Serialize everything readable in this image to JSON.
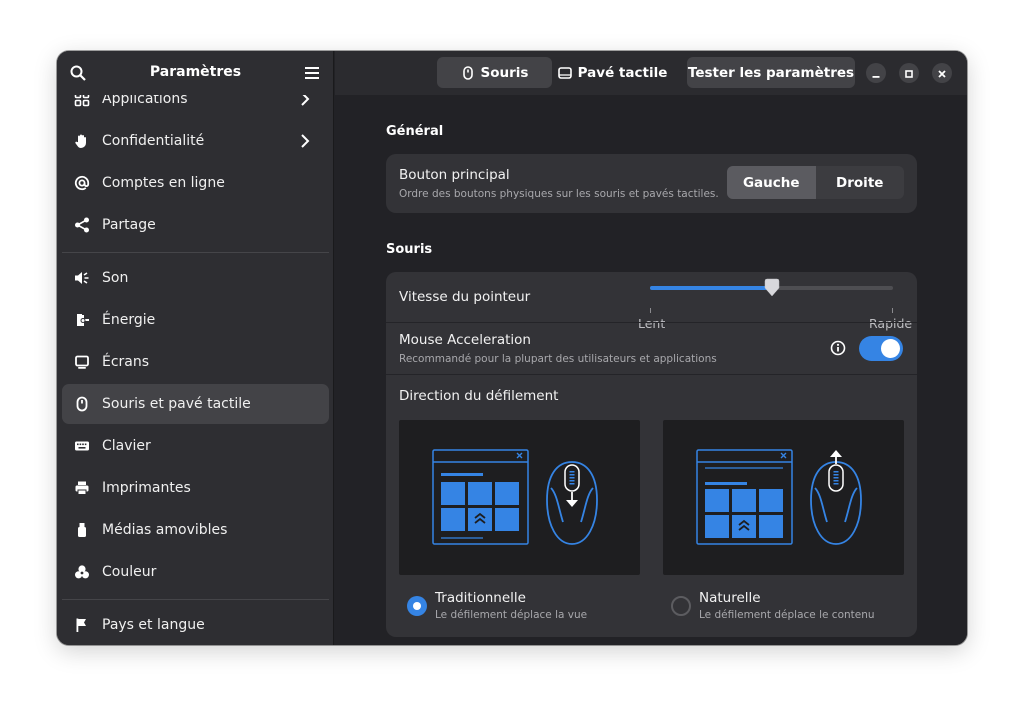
{
  "sidebar": {
    "title": "Paramètres",
    "items": [
      {
        "label": "Applications",
        "icon": "applications-icon"
      },
      {
        "label": "Confidentialité",
        "icon": "hand-icon"
      },
      {
        "label": "Comptes en ligne",
        "icon": "at-sign-icon"
      },
      {
        "label": "Partage",
        "icon": "share-icon"
      },
      {
        "label": "Son",
        "icon": "speaker-icon"
      },
      {
        "label": "Énergie",
        "icon": "battery-plug-icon"
      },
      {
        "label": "Écrans",
        "icon": "display-icon"
      },
      {
        "label": "Souris et pavé tactile",
        "icon": "mouse-icon"
      },
      {
        "label": "Clavier",
        "icon": "keyboard-icon"
      },
      {
        "label": "Imprimantes",
        "icon": "printer-icon"
      },
      {
        "label": "Médias amovibles",
        "icon": "usb-icon"
      },
      {
        "label": "Couleur",
        "icon": "color-icon"
      },
      {
        "label": "Pays et langue",
        "icon": "flag-icon"
      }
    ]
  },
  "header": {
    "tab_mouse": "Souris",
    "tab_touchpad": "Pavé tactile",
    "test_button": "Tester les paramètres"
  },
  "general": {
    "section_title": "Général",
    "primary_button_title": "Bouton principal",
    "primary_button_sub": "Ordre des boutons physiques sur les souris et pavés tactiles.",
    "left": "Gauche",
    "right": "Droite",
    "selected": "Gauche"
  },
  "mouse": {
    "section_title": "Souris",
    "speed_title": "Vitesse du pointeur",
    "speed_min_label": "Lent",
    "speed_max_label": "Rapide",
    "speed_value": 0.5,
    "accel_title": "Mouse Acceleration",
    "accel_sub": "Recommandé pour la plupart des utilisateurs et applications",
    "accel_enabled": true,
    "scroll_title": "Direction du défilement",
    "traditional_title": "Traditionnelle",
    "traditional_sub": "Le défilement déplace la vue",
    "natural_title": "Naturelle",
    "natural_sub": "Le défilement déplace le contenu",
    "scroll_selected": "Traditionnelle"
  },
  "colors": {
    "accent": "#3584e4",
    "window_bg": "#222226",
    "sidebar_bg": "#2e2e32",
    "card_bg": "#333337"
  }
}
